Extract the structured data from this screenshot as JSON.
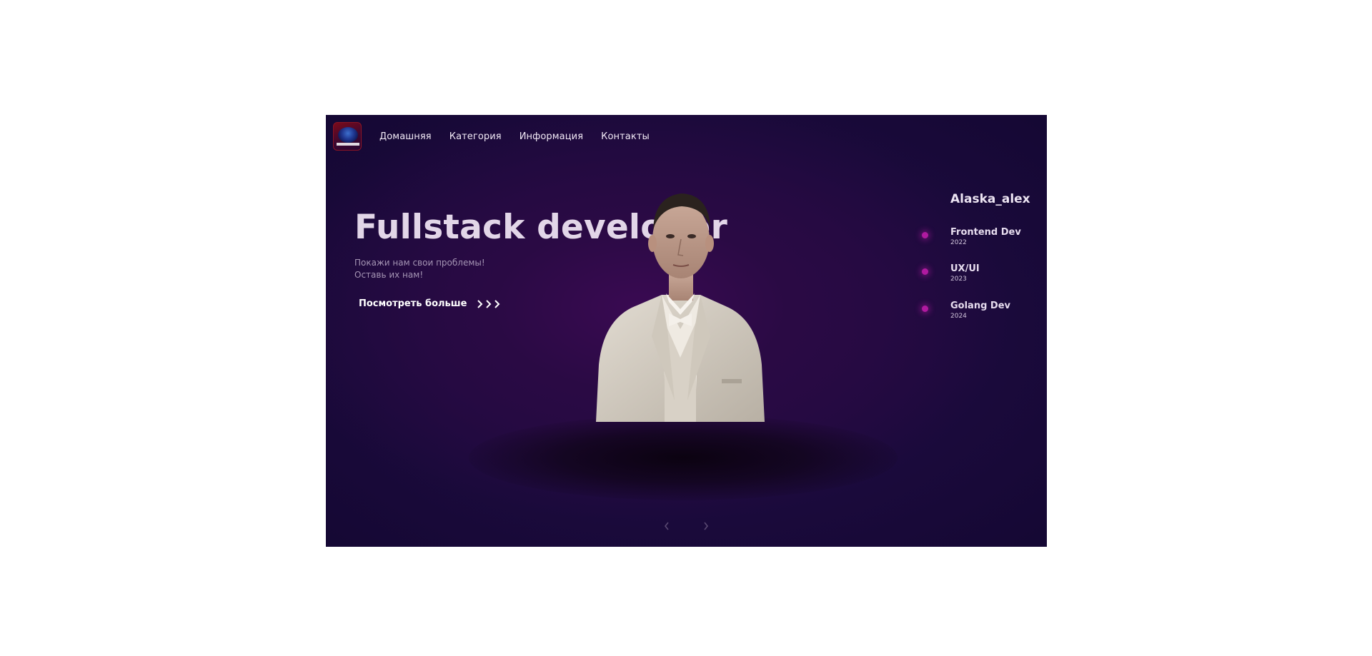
{
  "nav": {
    "logo_icon": "wolf-logo-icon",
    "items": [
      {
        "label": "Домашняя"
      },
      {
        "label": "Категория"
      },
      {
        "label": "Информация"
      },
      {
        "label": "Контакты"
      }
    ]
  },
  "hero": {
    "title": "Fullstack developer",
    "subtitle_line1": "Покажи нам свои проблемы!",
    "subtitle_line2": "Оставь их нам!",
    "more_button": "Посмотреть больше",
    "more_icon": "triple-chevron-right-icon"
  },
  "profile": {
    "name": "Alaska_alex",
    "timeline": [
      {
        "title": "Frontend Dev",
        "year": "2022"
      },
      {
        "title": "UX/UI",
        "year": "2023"
      },
      {
        "title": "Golang Dev",
        "year": "2024"
      }
    ]
  },
  "slider": {
    "prev_icon": "chevron-left-icon",
    "next_icon": "chevron-right-icon"
  },
  "colors": {
    "background": "#170835",
    "accent_dot": "#b01aa0",
    "title": "#e2d6e8",
    "subtitle": "#a595b4"
  }
}
